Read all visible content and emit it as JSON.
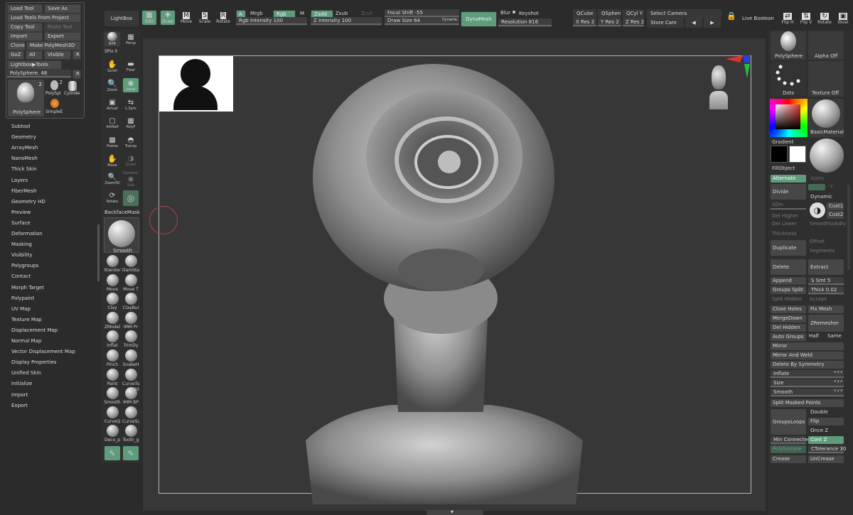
{
  "tool_panel": {
    "load_tool": "Load Tool",
    "save_as": "Save As",
    "load_from_project": "Load Tools From Project",
    "copy_tool": "Copy Tool",
    "paste_tool": "Paste Tool",
    "import": "Import",
    "export": "Export",
    "clone": "Clone",
    "make_polymesh": "Make PolyMesh3D",
    "goz": "GoZ",
    "all": "All",
    "visible": "Visible",
    "r": "R",
    "lightbox_tools": "Lightbox▶Tools",
    "current_tool": "PolySphere. 48",
    "r2": "R",
    "thumbs": [
      {
        "label": "PolySphere",
        "count": "2"
      },
      {
        "label": "PolySpl",
        "count": "2"
      },
      {
        "label": "Cylinde",
        "count": ""
      },
      {
        "label": "SimpleE",
        "count": ""
      }
    ]
  },
  "submenu": [
    "Subtool",
    "Geometry",
    "ArrayMesh",
    "NanoMesh",
    "Thick Skin",
    "Layers",
    "FiberMesh",
    "Geometry HD",
    "Preview",
    "Surface",
    "Deformation",
    "Masking",
    "Visibility",
    "Polygroups",
    "Contact",
    "Morph Target",
    "Polypaint",
    "UV Map",
    "Texture Map",
    "Displacement Map",
    "Normal Map",
    "Vector Displacement Map",
    "Display Properties",
    "Unified Skin",
    "Initialize",
    "Import",
    "Export"
  ],
  "top": {
    "lightbox": "LightBox",
    "edit": "Edit",
    "draw": "Draw",
    "move": "Move",
    "scale": "Scale",
    "rotate": "Rotate",
    "a": "A",
    "mrgb": "Mrgb",
    "rgb": "Rgb",
    "m": "M",
    "zadd": "Zadd",
    "zsub": "Zsub",
    "zcut": "Zcut",
    "rgb_intensity": "Rgb Intensity 100",
    "z_intensity": "Z Intensity 100",
    "focal_shift": "Focal Shift -55",
    "draw_size": "Draw Size 64",
    "dynamic": "Dynamic",
    "dynamesh": "DynaMesh",
    "blur": "Blur",
    "keyshot": "Keyshot",
    "resolution": "Resolution 816",
    "qcube": "QCube",
    "qsphere": "QSphere",
    "qcyl": "QCyl Y",
    "xres": "X Res 2",
    "yres": "Y Res 2",
    "zres": "Z Res 2",
    "select_camera": "Select Camera",
    "store_cam": "Store Cam",
    "live_boolean": "Live Boolean",
    "fliph": "Flip H",
    "flipv": "Flip V",
    "rotate_r": "Rotate",
    "ibval": "Ibval"
  },
  "shelf": {
    "bpr": "BPR",
    "persp": "Persp",
    "spix": "SPix 0",
    "scroll": "Scroll",
    "floor": "Floor",
    "zoom": "Zoom",
    "local": "Local",
    "actual": "Actual",
    "lsym": "L.Sym",
    "aahalf": "AAHalf",
    "polyf": "PolyF",
    "frame": "Frame",
    "transp": "Transp",
    "move": "Move",
    "ghost": "Ghost",
    "zoom3d": "Zoom3D",
    "solo": "Solo",
    "dynamic": "Dynamic",
    "rotate": "Rotate",
    "backface": "BackfaceMask",
    "smooth": "Smooth"
  },
  "brushes": [
    [
      "Standar",
      "DamSta"
    ],
    [
      "Move",
      "Move T"
    ],
    [
      "Clay",
      "ClayBui"
    ],
    [
      "ZModel",
      "IMM Pr"
    ],
    [
      "Inflat",
      "TrimDy"
    ],
    [
      "Pinch",
      "SnakeH"
    ],
    [
      "Paint",
      "CurveTu"
    ],
    [
      "Smooth",
      "IMM BP"
    ],
    [
      "CurveQ",
      "CurveSu"
    ],
    [
      "Deco_p",
      "Tooth_g"
    ]
  ],
  "brush_num": "20",
  "right": {
    "polysphere": "PolySphere",
    "alpha_off": "Alpha Off",
    "dots": "Dots",
    "texture_off": "Texture Off",
    "basic_material": "BasicMaterial",
    "gradient": "Gradient",
    "fill_object": "FillObject",
    "alternate": "Alternate",
    "apply": "Apply",
    "divide": "Divide",
    "dynamic": "Dynamic",
    "sdiv": "SDiv",
    "cust1": "Cust1",
    "cust2": "Cust2",
    "del_higher": "Del Higher",
    "del_lower": "Del Lower",
    "smooth_subdiv": "SmoothSubdiv",
    "thickness": "Thickness",
    "duplicate": "Duplicate",
    "offset": "Offset",
    "segments": "Segments",
    "delete": "Delete",
    "extract": "Extract",
    "append": "Append",
    "s_smt": "S Smt 5",
    "groups_split": "Groups Split",
    "thick": "Thick 0.02",
    "split_hidden": "Split Hidden",
    "accept": "Accept",
    "close_holes": "Close Holes",
    "fix_mesh": "Fix Mesh",
    "merge_down": "MergeDown",
    "del_hidden": "Del Hidden",
    "zremesher": "ZRemesher",
    "auto_groups": "Auto Groups",
    "half": "Half",
    "same": "Same",
    "mirror": "Mirror",
    "mirror_weld": "Mirror And Weld",
    "delete_symmetry": "Delete By Symmetry",
    "inflate": "Inflate",
    "size": "Size",
    "smooth": "Smooth",
    "xyz": "x y z",
    "split_masked": "Split Masked Points",
    "groups_loops": "GroupsLoops",
    "double": "Double",
    "flip": "Flip",
    "once_z": "Once Z",
    "min_connected": "Min Connected",
    "cont_z": "Cont Z",
    "poly_sample": "PolySample",
    "ctolerance": "CTolerance 30",
    "crease": "Crease",
    "uncrease": "UnCrease"
  },
  "colors": {
    "accent": "#5e9c7c",
    "bg": "#2b2b2b",
    "panel": "#3a3a3a",
    "canvas": "#373737"
  }
}
